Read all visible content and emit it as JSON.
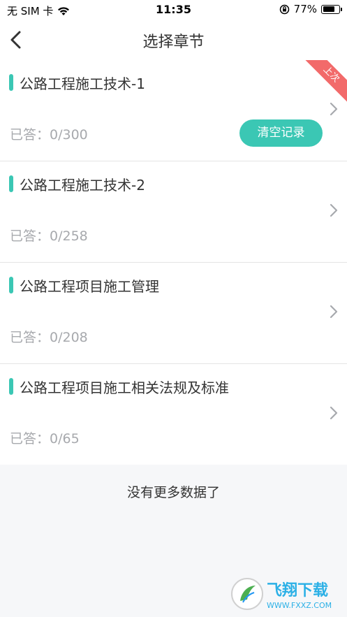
{
  "status": {
    "carrier": "无 SIM 卡",
    "time": "11:35",
    "battery": "77%",
    "battery_level": 0.77
  },
  "nav": {
    "title": "选择章节"
  },
  "chapters": [
    {
      "title": "公路工程施工技术-1",
      "answered": "已答：0/300",
      "badge": "上次",
      "action": "清空记录"
    },
    {
      "title": "公路工程施工技术-2",
      "answered": "已答：0/258"
    },
    {
      "title": "公路工程项目施工管理",
      "answered": "已答：0/208"
    },
    {
      "title": "公路工程项目施工相关法规及标准",
      "answered": "已答：0/65"
    }
  ],
  "footer": {
    "no_more": "没有更多数据了"
  },
  "watermark": {
    "brand": "飞翔下载",
    "url": "WWW.FXXZ.COM"
  },
  "colors": {
    "accent": "#3bc7b4",
    "badge": "#f26a6a",
    "muted": "#a7a9ad"
  }
}
